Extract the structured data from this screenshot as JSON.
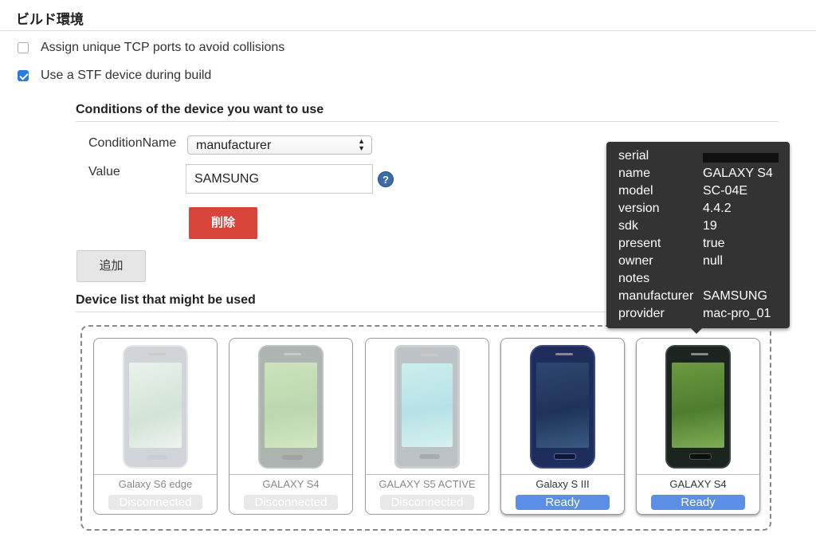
{
  "section": {
    "title": "ビルド環境"
  },
  "options": [
    {
      "label": "Assign unique TCP ports to avoid collisions",
      "checked": false
    },
    {
      "label": "Use a STF device during build",
      "checked": true
    }
  ],
  "conditions": {
    "title": "Conditions of the device you want to use",
    "condition_name_label": "ConditionName",
    "condition_name_value": "manufacturer",
    "value_label": "Value",
    "value": "SAMSUNG",
    "help_icon": "?",
    "delete_label": "削除",
    "add_label": "追加"
  },
  "device_list": {
    "title": "Device list that might be used",
    "devices": [
      {
        "name": "Galaxy S6 edge",
        "status": "Disconnected"
      },
      {
        "name": "GALAXY S4",
        "status": "Disconnected"
      },
      {
        "name": "GALAXY S5 ACTIVE",
        "status": "Disconnected"
      },
      {
        "name": "Galaxy S III",
        "status": "Ready"
      },
      {
        "name": "GALAXY S4",
        "status": "Ready"
      }
    ]
  },
  "tooltip": {
    "rows": [
      {
        "key": "serial",
        "value": ""
      },
      {
        "key": "name",
        "value": "GALAXY S4"
      },
      {
        "key": "model",
        "value": "SC-04E"
      },
      {
        "key": "version",
        "value": "4.4.2"
      },
      {
        "key": "sdk",
        "value": "19"
      },
      {
        "key": "present",
        "value": "true"
      },
      {
        "key": "owner",
        "value": "null"
      },
      {
        "key": "notes",
        "value": ""
      },
      {
        "key": "manufacturer",
        "value": "SAMSUNG"
      },
      {
        "key": "provider",
        "value": "mac-pro_01"
      }
    ]
  },
  "colors": {
    "delete_button": "#d9443a",
    "ready_badge": "#5b8fe6",
    "checkbox_checked": "#2a7ae2"
  }
}
